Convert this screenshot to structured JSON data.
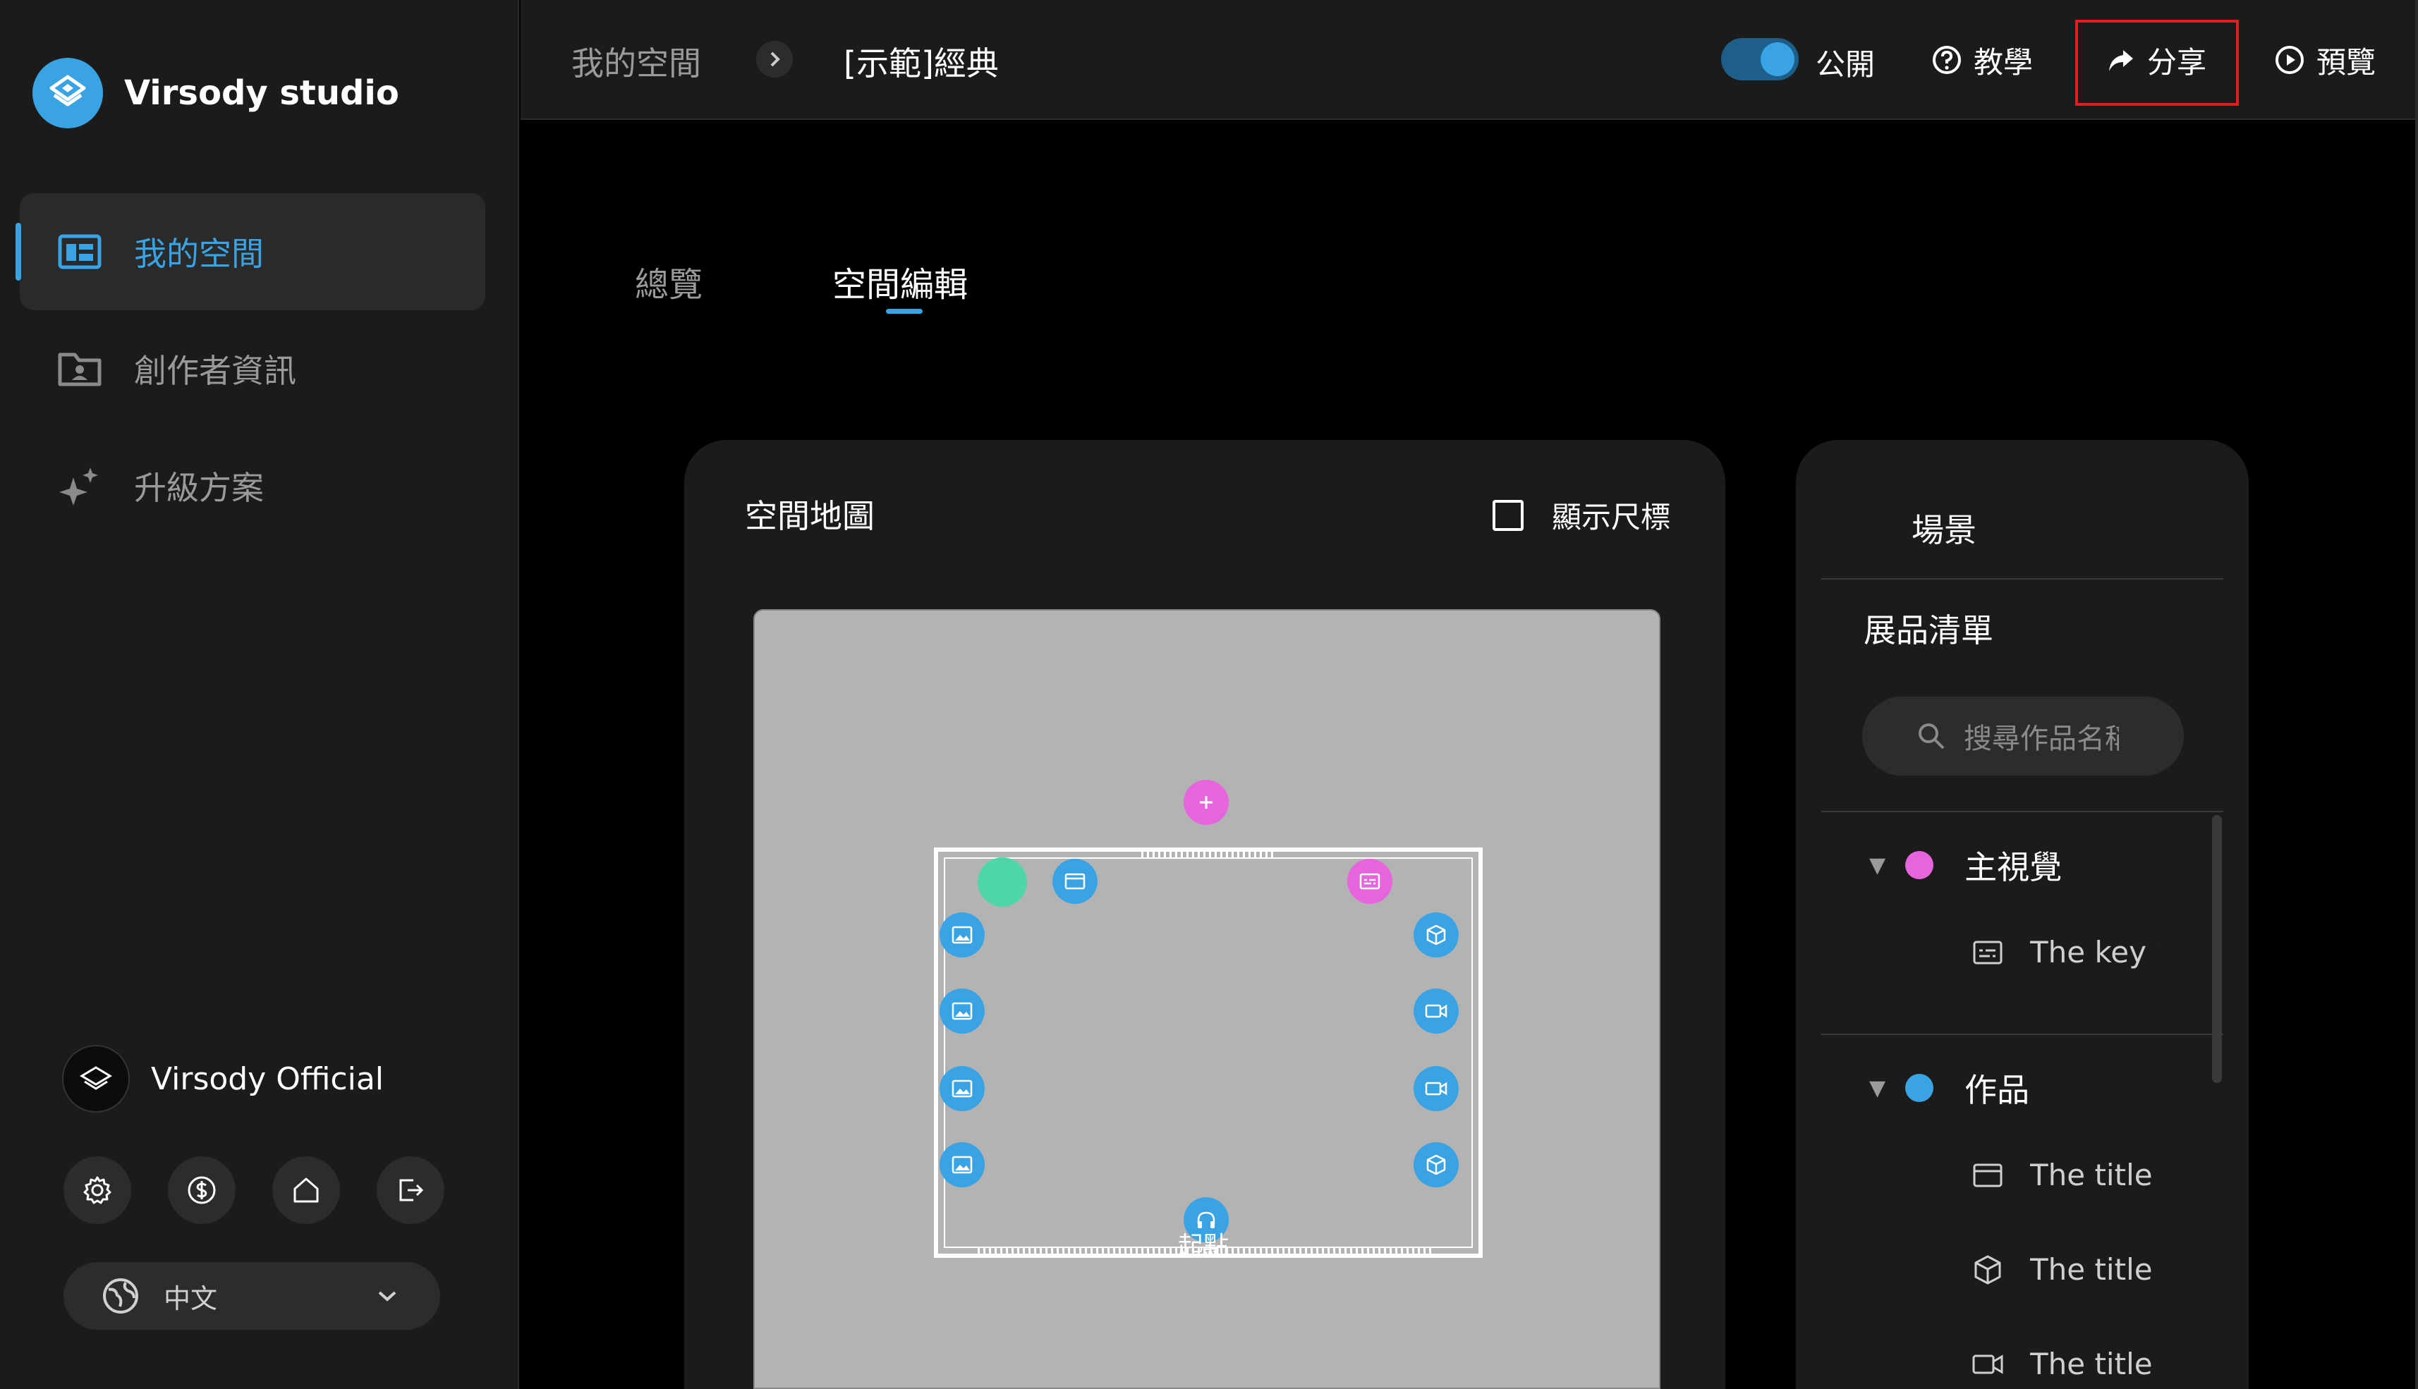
{
  "brand": {
    "name": "Virsody studio",
    "accent": "#3aa3e3"
  },
  "sidebar": {
    "items": [
      {
        "label": "我的空間",
        "icon": "layout-icon",
        "active": true
      },
      {
        "label": "創作者資訊",
        "icon": "profile-folder-icon",
        "active": false
      },
      {
        "label": "升級方案",
        "icon": "sparkle-icon",
        "active": false
      }
    ],
    "user": {
      "name": "Virsody Official"
    },
    "language": {
      "label": "中文"
    }
  },
  "header": {
    "breadcrumb": [
      "我的空間",
      "[示範]經典"
    ],
    "public_toggle": {
      "label": "公開",
      "on": true
    },
    "tutorial_label": "教學",
    "share_label": "分享",
    "preview_label": "預覽"
  },
  "tabs": [
    {
      "label": "總覽",
      "active": false
    },
    {
      "label": "空間編輯",
      "active": true
    }
  ],
  "map": {
    "title": "空間地圖",
    "ruler_label": "顯示尺標",
    "ruler_checked": false,
    "start_label": "起點"
  },
  "exhibits": {
    "scene_label": "場景",
    "list_title": "展品清單",
    "search_placeholder": "搜尋作品名稱",
    "groups": [
      {
        "label": "主視覺",
        "color": "#e665dd",
        "items": [
          {
            "label": "The key v",
            "icon": "caption-icon"
          }
        ]
      },
      {
        "label": "作品",
        "color": "#3aa3e3",
        "items": [
          {
            "label": "The title c",
            "icon": "frame-icon"
          },
          {
            "label": "The title c",
            "icon": "cube-icon"
          },
          {
            "label": "The title c",
            "icon": "video-icon"
          }
        ]
      }
    ]
  }
}
